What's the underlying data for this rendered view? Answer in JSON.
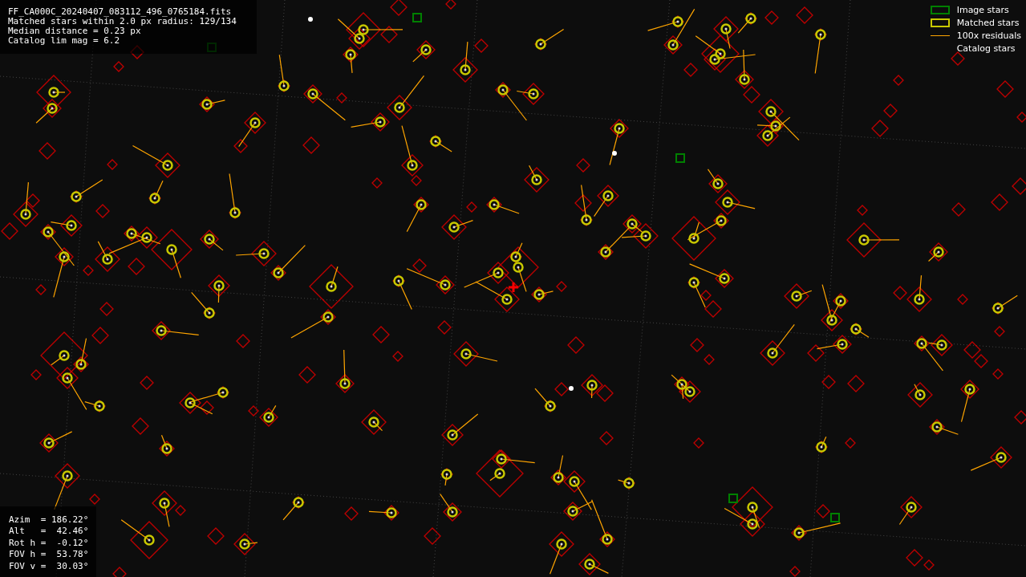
{
  "file_info": {
    "lines": [
      "FF_CA000C_20240407_083112_496_0765184.fits",
      "Matched stars within 2.0 px radius: 129/134",
      "Median distance = 0.23 px",
      "Catalog lim mag = 6.2"
    ]
  },
  "legend": [
    {
      "kind": "box",
      "label": "Image stars",
      "color": "#008000"
    },
    {
      "kind": "box",
      "label": "Matched stars",
      "color": "#c8c800"
    },
    {
      "kind": "line",
      "label": "100x residuals",
      "color": "#ffa500"
    },
    {
      "kind": "none",
      "label": "Catalog stars"
    }
  ],
  "pointing": {
    "lines": [
      "Azim  = 186.22°",
      "Alt   =  42.46°",
      "Rot h =  -0.12°",
      "FOV h =  53.78°",
      "FOV v =  30.03°"
    ]
  }
}
